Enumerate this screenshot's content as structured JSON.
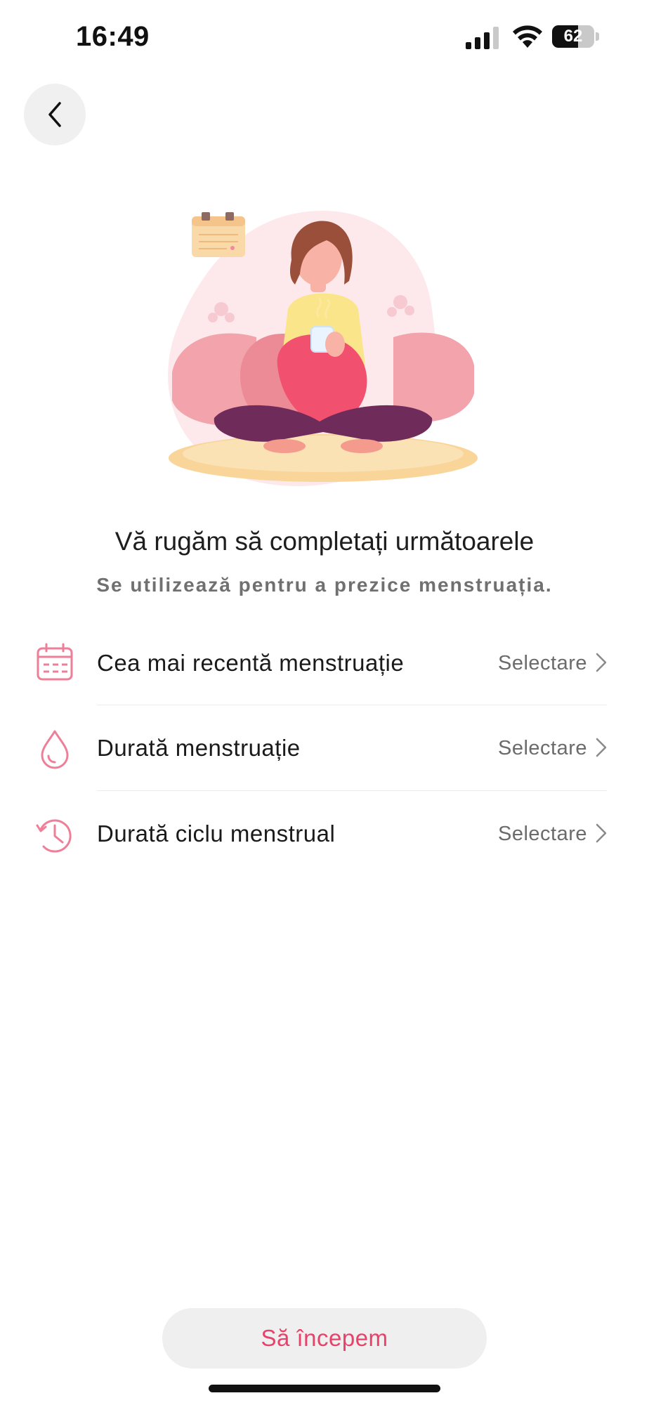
{
  "status_bar": {
    "time": "16:49",
    "battery_percent": "62",
    "battery_level": 0.62
  },
  "header": {
    "back_icon": "chevron-left-icon"
  },
  "intro": {
    "heading": "Vă rugăm să completați următoarele",
    "subheading": "Se utilizează pentru a prezice menstruația."
  },
  "settings": {
    "items": [
      {
        "icon": "calendar-icon",
        "label": "Cea mai recentă menstruație",
        "value": "Selectare"
      },
      {
        "icon": "drop-icon",
        "label": "Durată menstruație",
        "value": "Selectare"
      },
      {
        "icon": "clock-icon",
        "label": "Durată ciclu menstrual",
        "value": "Selectare"
      }
    ]
  },
  "footer": {
    "start_label": "Să începem"
  },
  "colors": {
    "accent": "#e8426b",
    "icon_pink": "#ee7f98",
    "muted_text": "#6b6b6b"
  }
}
